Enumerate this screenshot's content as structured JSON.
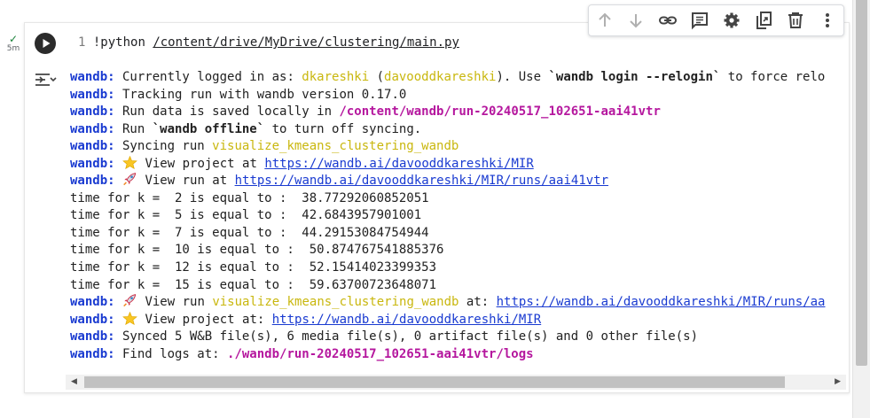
{
  "cell": {
    "exec_check": "✓",
    "exec_time": "5m",
    "line_number": "1",
    "code_prefix": "!python ",
    "code_path": "/content/drive/MyDrive/clustering/main.py"
  },
  "toolbar": {
    "icons": [
      "arrow-up-icon",
      "arrow-down-icon",
      "link-icon",
      "comment-icon",
      "gear-icon",
      "mirror-cell-icon",
      "trash-icon",
      "more-vert-icon"
    ]
  },
  "output": {
    "prefix": "wandb:",
    "line1": {
      "a": " Currently logged in as: ",
      "user": "dkareshki",
      "b": " (",
      "entity": "davooddkareshki",
      "c": "). Use ",
      "cmd": "`wandb login --relogin`",
      "d": " to force relo"
    },
    "line2": " Tracking run with wandb version 0.17.0",
    "line3": {
      "a": " Run data is saved locally in ",
      "path": "/content/wandb/run-20240517_102651-aai41vtr"
    },
    "line4": {
      "a": " Run ",
      "cmd": "`wandb offline`",
      "b": " to turn off syncing."
    },
    "line5": {
      "a": " Syncing run ",
      "run": "visualize_kmeans_clustering_wandb"
    },
    "line6": {
      "a": " View project at ",
      "url": "https://wandb.ai/davooddkareshki/MIR"
    },
    "line7": {
      "a": " View run at ",
      "url": "https://wandb.ai/davooddkareshki/MIR/runs/aai41vtr"
    },
    "timings": [
      "time for k =  2 is equal to :  38.77292060852051",
      "time for k =  5 is equal to :  42.6843957901001",
      "time for k =  7 is equal to :  44.29153084754944",
      "time for k =  10 is equal to :  50.874767541885376",
      "time for k =  12 is equal to :  52.15414023399353",
      "time for k =  15 is equal to :  59.63700723648071"
    ],
    "line14": {
      "a": " View run ",
      "run": "visualize_kmeans_clustering_wandb",
      "b": " at: ",
      "url": "https://wandb.ai/davooddkareshki/MIR/runs/aa"
    },
    "line15": {
      "a": " View project at: ",
      "url": "https://wandb.ai/davooddkareshki/MIR"
    },
    "line16": " Synced 5 W&B file(s), 6 media file(s), 0 artifact file(s) and 0 other file(s)",
    "line17": {
      "a": " Find logs at: ",
      "path": "./wandb/run-20240517_102651-aai41vtr/logs"
    }
  },
  "scrollbar": {
    "left_arrow": "◀",
    "right_arrow": "▶"
  }
}
